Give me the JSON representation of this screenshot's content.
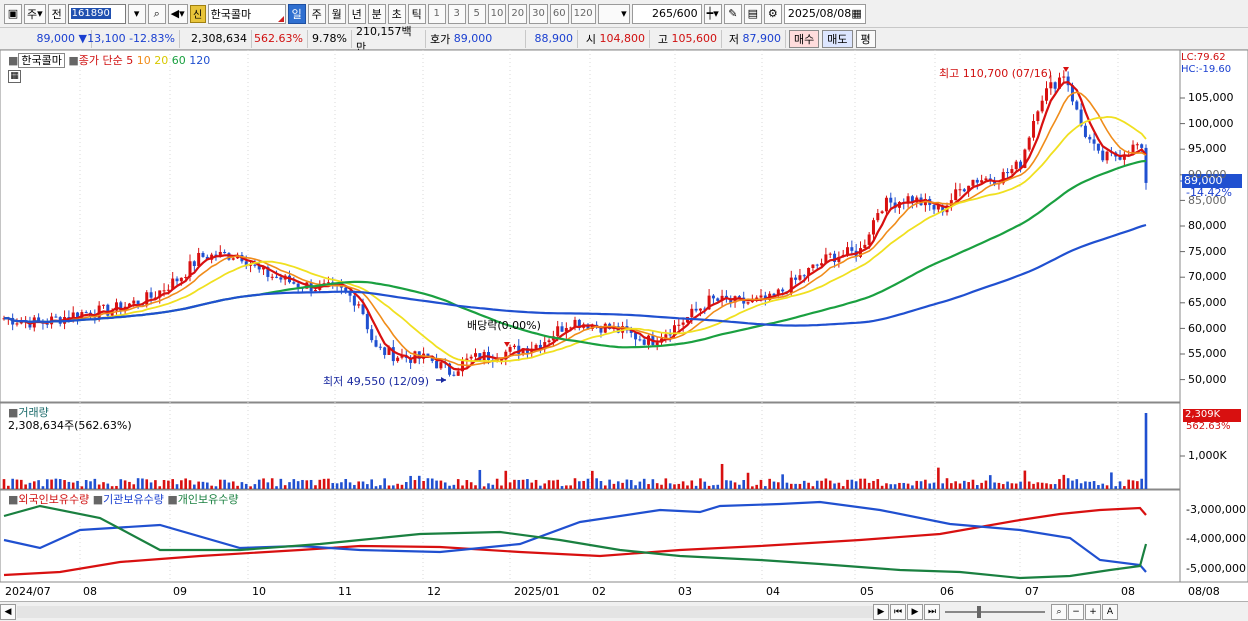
{
  "toolbar": {
    "market_label": "주",
    "prev_label": "전",
    "code": "161890",
    "new_badge": "신",
    "name": "한국콜마",
    "periods": [
      "일",
      "주",
      "월",
      "년",
      "분",
      "초",
      "틱"
    ],
    "active_period": "일",
    "intervals": [
      "1",
      "3",
      "5",
      "10",
      "20",
      "30",
      "60",
      "120"
    ],
    "count": "265",
    "count_max": "/600",
    "date": "2025/08/08"
  },
  "quote": {
    "price": "89,000",
    "change": "13,100",
    "change_pct": "-12.83%",
    "volume": "2,308,634",
    "vol_ratio": "562.63%",
    "turnover": "9.78%",
    "amount": "210,157백만",
    "bid_ask_label": "호가",
    "ask": "89,000",
    "bid": "88,900",
    "open_label": "시",
    "open": "104,800",
    "high_label": "고",
    "high": "105,600",
    "low_label": "저",
    "low": "87,900",
    "buy_label": "매수",
    "sell_label": "매도",
    "eval_label": "평"
  },
  "price_panel": {
    "stock_tag": "한국콜마",
    "ma_label": "종가 단순",
    "ma_periods": [
      "5",
      "10",
      "20",
      "60",
      "120"
    ],
    "ma_colors": [
      "#d81010",
      "#f08c1a",
      "#f0e020",
      "#1aa040",
      "#2050d0"
    ],
    "lc_label": "LC:79.62",
    "hc_label": "HC:-19.60",
    "high_note": "최고 110,700 (07/16)",
    "low_note": "최저 49,550 (12/09)",
    "dividend_note": "배당락(0.00%)",
    "current_price": "89,000",
    "current_pct": "-14.42%",
    "y_ticks": [
      "105,000",
      "100,000",
      "95,000",
      "90,000",
      "85,000",
      "80,000",
      "75,000",
      "70,000",
      "65,000",
      "60,000",
      "55,000",
      "50,000"
    ]
  },
  "volume_panel": {
    "title": "거래량",
    "value": "2,308,634주(562.63%)",
    "axis_tick": "1,000K",
    "current": "2,309K",
    "current_pct": "562.63%"
  },
  "holdings_panel": {
    "series": [
      "외국인보유수량",
      "기관보유수량",
      "개인보유수량"
    ],
    "series_colors": [
      "#d81010",
      "#2050d0",
      "#1a8040"
    ],
    "axis_ticks": [
      "-3,000,000",
      "-4,000,000",
      "-5,000,000"
    ]
  },
  "x_axis": {
    "ticks": [
      "2024/07",
      "08",
      "09",
      "10",
      "11",
      "12",
      "2025/01",
      "02",
      "03",
      "04",
      "05",
      "06",
      "07",
      "08"
    ],
    "end_label": "08/08"
  },
  "chart_data": {
    "type": "line",
    "ma_periods": [
      5,
      10,
      20,
      60,
      120
    ],
    "high": 110700,
    "low": 49550,
    "current": 89000,
    "ylim": [
      47000,
      110700
    ]
  }
}
